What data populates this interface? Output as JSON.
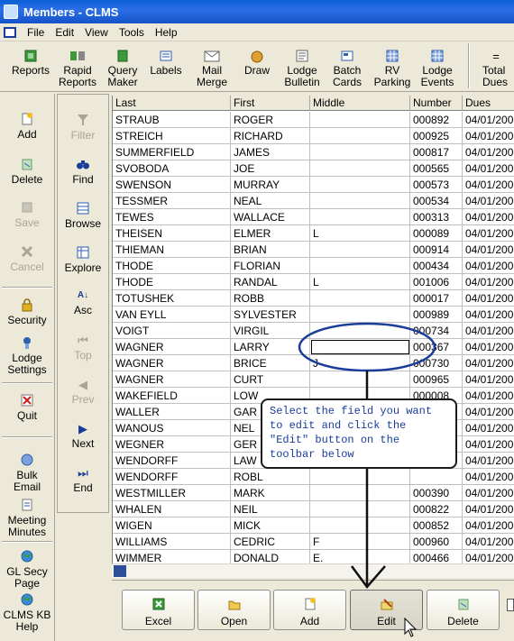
{
  "window": {
    "title": "Members - CLMS"
  },
  "menu": [
    "File",
    "Edit",
    "View",
    "Tools",
    "Help"
  ],
  "toolbar": [
    {
      "id": "reports",
      "label": "Reports",
      "icon": "reports-icon"
    },
    {
      "id": "rapid-reports",
      "label": "Rapid Reports",
      "icon": "rapid-reports-icon"
    },
    {
      "id": "query-maker",
      "label": "Query Maker",
      "icon": "query-maker-icon"
    },
    {
      "id": "labels",
      "label": "Labels",
      "icon": "labels-icon"
    },
    {
      "id": "mail-merge",
      "label": "Mail Merge",
      "icon": "mail-merge-icon"
    },
    {
      "id": "draw",
      "label": "Draw",
      "icon": "draw-icon"
    },
    {
      "id": "lodge-bulletin",
      "label": "Lodge Bulletin",
      "icon": "lodge-bulletin-icon"
    },
    {
      "id": "batch-cards",
      "label": "Batch Cards",
      "icon": "batch-cards-icon"
    },
    {
      "id": "rv-parking",
      "label": "RV Parking",
      "icon": "rv-parking-icon"
    },
    {
      "id": "lodge-events",
      "label": "Lodge Events",
      "icon": "lodge-events-icon"
    },
    {
      "id": "total-dues",
      "label": "Total Dues",
      "icon": "total-dues-icon"
    }
  ],
  "left_panel": [
    {
      "id": "add",
      "label": "Add",
      "disabled": false
    },
    {
      "id": "delete",
      "label": "Delete",
      "disabled": false
    },
    {
      "id": "save",
      "label": "Save",
      "disabled": true
    },
    {
      "id": "cancel",
      "label": "Cancel",
      "disabled": true
    },
    {
      "id": "security",
      "label": "Security",
      "disabled": false
    },
    {
      "id": "lodge-settings",
      "label": "Lodge Settings",
      "disabled": false
    },
    {
      "id": "quit",
      "label": "Quit",
      "disabled": false
    },
    {
      "id": "bulk-email",
      "label": "Bulk Email",
      "disabled": false
    },
    {
      "id": "meeting-minutes",
      "label": "Meeting Minutes",
      "disabled": false
    },
    {
      "id": "gl-secy-page",
      "label": "GL Secy Page",
      "disabled": false
    },
    {
      "id": "clms-kb-help",
      "label": "CLMS KB Help",
      "disabled": false
    }
  ],
  "nav_panel": [
    {
      "id": "filter",
      "label": "Filter",
      "disabled": true
    },
    {
      "id": "find",
      "label": "Find",
      "disabled": false
    },
    {
      "id": "browse",
      "label": "Browse",
      "disabled": false
    },
    {
      "id": "explore",
      "label": "Explore",
      "disabled": false
    },
    {
      "id": "asc",
      "label": "Asc",
      "disabled": false
    },
    {
      "id": "top",
      "label": "Top",
      "disabled": true
    },
    {
      "id": "prev",
      "label": "Prev",
      "disabled": true
    },
    {
      "id": "next",
      "label": "Next",
      "disabled": false
    },
    {
      "id": "end",
      "label": "End",
      "disabled": false
    }
  ],
  "grid": {
    "columns": [
      "Last",
      "First",
      "Middle",
      "Number",
      "Dues"
    ],
    "rows": [
      [
        "STRAUB",
        "ROGER",
        "",
        "000892",
        "04/01/200"
      ],
      [
        "STREICH",
        "RICHARD",
        "",
        "000925",
        "04/01/200"
      ],
      [
        "SUMMERFIELD",
        "JAMES",
        "",
        "000817",
        "04/01/200"
      ],
      [
        "SVOBODA",
        "JOE",
        "",
        "000565",
        "04/01/200"
      ],
      [
        "SWENSON",
        "MURRAY",
        "",
        "000573",
        "04/01/200"
      ],
      [
        "TESSMER",
        "NEAL",
        "",
        "000534",
        "04/01/200"
      ],
      [
        "TEWES",
        "WALLACE",
        "",
        "000313",
        "04/01/200"
      ],
      [
        "THEISEN",
        "ELMER",
        "L",
        "000089",
        "04/01/200"
      ],
      [
        "THIEMAN",
        "BRIAN",
        "",
        "000914",
        "04/01/200"
      ],
      [
        "THODE",
        "FLORIAN",
        "",
        "000434",
        "04/01/200"
      ],
      [
        "THODE",
        "RANDAL",
        "L",
        "001006",
        "04/01/200"
      ],
      [
        "TOTUSHEK",
        "ROBB",
        "",
        "000017",
        "04/01/200"
      ],
      [
        "VAN EYLL",
        "SYLVESTER",
        "",
        "000989",
        "04/01/200"
      ],
      [
        "VOIGT",
        "VIRGIL",
        "",
        "000734",
        "04/01/200"
      ],
      [
        "WAGNER",
        "LARRY",
        "",
        "000367",
        "04/01/200"
      ],
      [
        "WAGNER",
        "BRICE",
        "J",
        "000730",
        "04/01/200"
      ],
      [
        "WAGNER",
        "CURT",
        "",
        "000965",
        "04/01/200"
      ],
      [
        "WAKEFIELD",
        "LOW",
        "",
        "000008",
        "04/01/200"
      ],
      [
        "WALLER",
        "GAR",
        "",
        "",
        "04/01/200"
      ],
      [
        "WANOUS",
        "NEL",
        "",
        "",
        "04/01/200"
      ],
      [
        "WEGNER",
        "GER",
        "",
        "",
        "04/01/200"
      ],
      [
        "WENDORFF",
        "LAW",
        "",
        "",
        "04/01/200"
      ],
      [
        "WENDORFF",
        "ROBL",
        "",
        "",
        "04/01/200"
      ],
      [
        "WESTMILLER",
        "MARK",
        "",
        "000390",
        "04/01/200"
      ],
      [
        "WHALEN",
        "NEIL",
        "",
        "000822",
        "04/01/200"
      ],
      [
        "WIGEN",
        "MICK",
        "",
        "000852",
        "04/01/200"
      ],
      [
        "WILLIAMS",
        "CEDRIC",
        "F",
        "000960",
        "04/01/200"
      ],
      [
        "WIMMER",
        "DONALD",
        "E.",
        "000466",
        "04/01/200"
      ]
    ]
  },
  "callout": {
    "text": "Select the field you want to edit and click the \"Edit\" button on the toolbar below"
  },
  "bottom_buttons": [
    {
      "id": "excel",
      "label": "Excel",
      "icon": "excel-icon"
    },
    {
      "id": "open",
      "label": "Open",
      "icon": "open-folder-icon"
    },
    {
      "id": "add",
      "label": "Add",
      "icon": "add-icon"
    },
    {
      "id": "edit",
      "label": "Edit",
      "icon": "edit-icon"
    },
    {
      "id": "delete",
      "label": "Delete",
      "icon": "delete-icon"
    }
  ],
  "colors": {
    "annotation_blue": "#1a3d9a",
    "titlebar": "#0a5fd8"
  }
}
